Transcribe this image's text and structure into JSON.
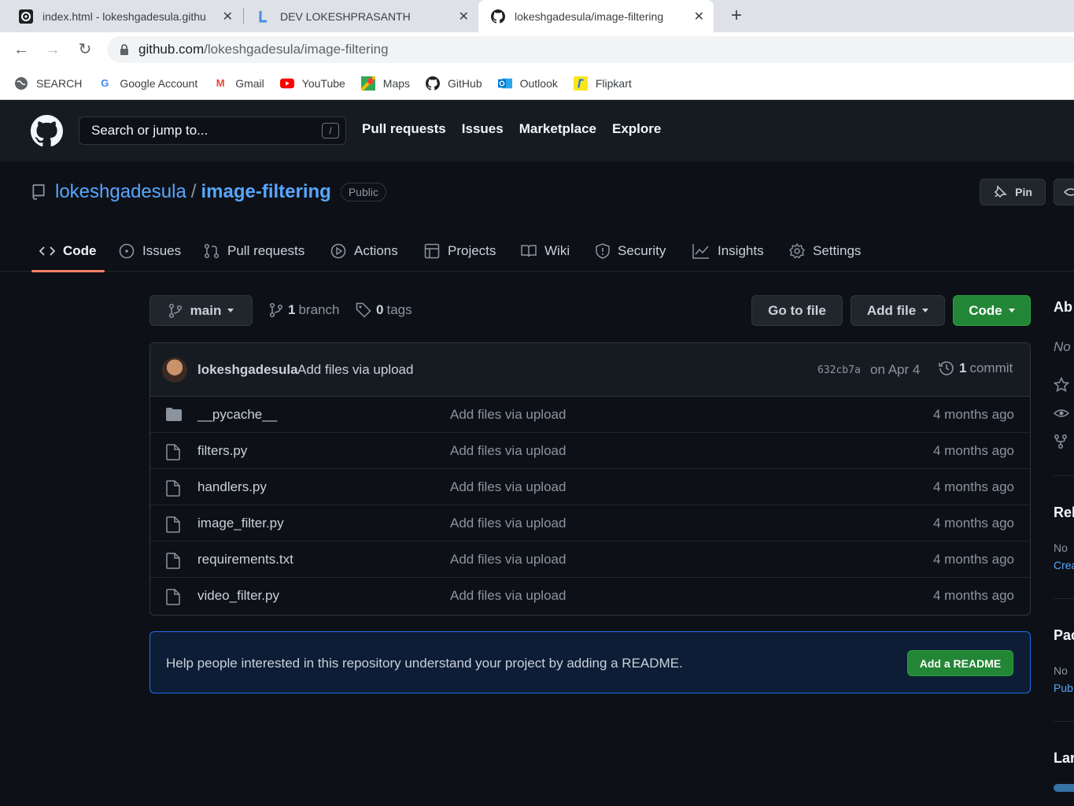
{
  "browser": {
    "tabs": [
      {
        "title": "index.html - lokeshgadesula.githu"
      },
      {
        "title": "DEV LOKESHPRASANTH"
      },
      {
        "title": "lokeshgadesula/image-filtering"
      }
    ],
    "url_host": "github.com",
    "url_path": "/lokeshgadesula/image-filtering",
    "bookmarks": [
      "SEARCH",
      "Google Account",
      "Gmail",
      "YouTube",
      "Maps",
      "GitHub",
      "Outlook",
      "Flipkart"
    ]
  },
  "gh": {
    "search_placeholder": "Search or jump to...",
    "search_key": "/",
    "nav": [
      "Pull requests",
      "Issues",
      "Marketplace",
      "Explore"
    ]
  },
  "repo": {
    "owner": "lokeshgadesula",
    "separator": "/",
    "name": "image-filtering",
    "visibility": "Public",
    "pin_label": "Pin",
    "tabs": [
      "Code",
      "Issues",
      "Pull requests",
      "Actions",
      "Projects",
      "Wiki",
      "Security",
      "Insights",
      "Settings"
    ]
  },
  "toolbar": {
    "branch": "main",
    "branch_count": "1",
    "branch_label": "branch",
    "tag_count": "0",
    "tag_label": "tags",
    "go_to_file": "Go to file",
    "add_file": "Add file",
    "code": "Code"
  },
  "commit": {
    "author": "lokeshgadesula",
    "message": "Add files via upload",
    "sha": "632cb7a",
    "date": "on Apr 4",
    "count": "1",
    "count_label": "commit"
  },
  "files": [
    {
      "name": "__pycache__",
      "type": "folder",
      "message": "Add files via upload",
      "age": "4 months ago"
    },
    {
      "name": "filters.py",
      "type": "file",
      "message": "Add files via upload",
      "age": "4 months ago"
    },
    {
      "name": "handlers.py",
      "type": "file",
      "message": "Add files via upload",
      "age": "4 months ago"
    },
    {
      "name": "image_filter.py",
      "type": "file",
      "message": "Add files via upload",
      "age": "4 months ago"
    },
    {
      "name": "requirements.txt",
      "type": "file",
      "message": "Add files via upload",
      "age": "4 months ago"
    },
    {
      "name": "video_filter.py",
      "type": "file",
      "message": "Add files via upload",
      "age": "4 months ago"
    }
  ],
  "readme": {
    "message": "Help people interested in this repository understand your project by adding a README.",
    "button": "Add a README"
  },
  "sidebar": {
    "about": "Ab",
    "no_desc": "No",
    "releases": "Rel",
    "releases_none": "No",
    "releases_link": "Crea",
    "packages": "Pac",
    "packages_none": "No",
    "packages_link": "Pub",
    "languages": "Lar"
  },
  "colors": {
    "accent_green": "#238636",
    "link_blue": "#58a6ff",
    "tab_underline": "#f78166"
  }
}
